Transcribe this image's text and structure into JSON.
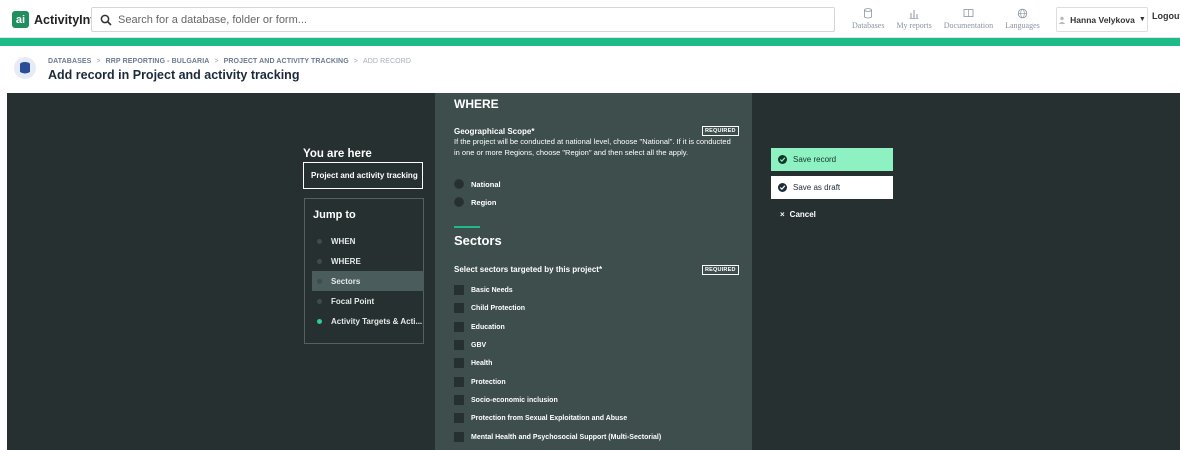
{
  "app": {
    "name": "ActivityInfo"
  },
  "search": {
    "placeholder": "Search for a database, folder or form..."
  },
  "topnav": [
    {
      "label": "Databases",
      "icon": "database-icon"
    },
    {
      "label": "My reports",
      "icon": "bar-chart-icon"
    },
    {
      "label": "Documentation",
      "icon": "book-icon"
    },
    {
      "label": "Languages",
      "icon": "globe-icon"
    }
  ],
  "user": {
    "name": "Hanna Velykova",
    "logout": "Logout"
  },
  "breadcrumb": {
    "items": [
      "DATABASES",
      "RRP REPORTING - BULGARIA",
      "PROJECT AND ACTIVITY TRACKING",
      "ADD RECORD"
    ],
    "separator": ">"
  },
  "page": {
    "title": "Add record in Project and activity tracking"
  },
  "sidebar": {
    "you_are_here": "You are here",
    "current_form": "Project and activity tracking",
    "jump_to": "Jump to",
    "items": [
      {
        "label": "WHEN",
        "active": false,
        "complete": false
      },
      {
        "label": "WHERE",
        "active": false,
        "complete": false
      },
      {
        "label": "Sectors",
        "active": true,
        "complete": false
      },
      {
        "label": "Focal Point",
        "active": false,
        "complete": false
      },
      {
        "label": "Activity Targets & Acti...",
        "active": false,
        "complete": true
      }
    ]
  },
  "form": {
    "where_title": "WHERE",
    "geo_label": "Geographical Scope*",
    "required": "REQUIRED",
    "geo_desc": "If the project will be conducted at national level, choose \"National\". If it is conducted in one or more Regions, choose \"Region\" and then select all the apply.",
    "geo_options": [
      "National",
      "Region"
    ],
    "sectors_title": "Sectors",
    "sectors_label": "Select sectors targeted by this project*",
    "sectors": [
      "Basic Needs",
      "Child Protection",
      "Education",
      "GBV",
      "Health",
      "Protection",
      "Socio-economic inclusion",
      "Protection from Sexual Exploitation and Abuse",
      "Mental Health and Psychosocial Support (Multi-Sectorial)"
    ]
  },
  "actions": {
    "save": "Save record",
    "draft": "Save as draft",
    "cancel": "Cancel"
  },
  "colors": {
    "accent": "#1dbb87",
    "dark_bg": "#263030",
    "panel_bg": "#3d4e4d",
    "save_btn": "#8ef1c1"
  }
}
